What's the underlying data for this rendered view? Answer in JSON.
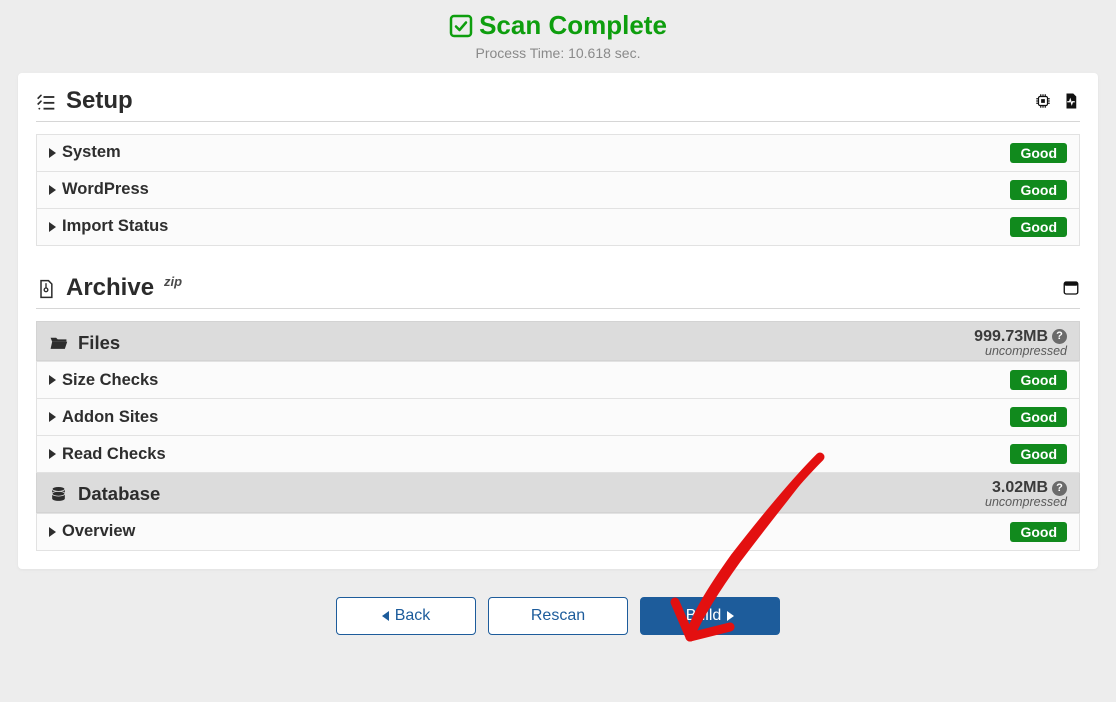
{
  "header": {
    "title": "Scan Complete",
    "process_time": "Process Time: 10.618 sec."
  },
  "setup": {
    "title": "Setup",
    "rows": [
      {
        "label": "System",
        "status": "Good"
      },
      {
        "label": "WordPress",
        "status": "Good"
      },
      {
        "label": "Import Status",
        "status": "Good"
      }
    ]
  },
  "archive": {
    "title": "Archive",
    "format": "zip",
    "files": {
      "title": "Files",
      "size": "999.73MB",
      "note": "uncompressed",
      "rows": [
        {
          "label": "Size Checks",
          "status": "Good"
        },
        {
          "label": "Addon Sites",
          "status": "Good"
        },
        {
          "label": "Read Checks",
          "status": "Good"
        }
      ]
    },
    "database": {
      "title": "Database",
      "size": "3.02MB",
      "note": "uncompressed",
      "rows": [
        {
          "label": "Overview",
          "status": "Good"
        }
      ]
    }
  },
  "buttons": {
    "back": "Back",
    "rescan": "Rescan",
    "build": "Build"
  }
}
